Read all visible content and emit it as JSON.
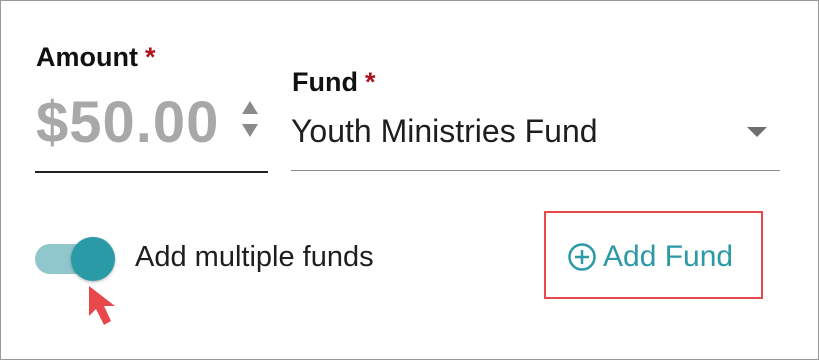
{
  "amount": {
    "label": "Amount",
    "required_marker": "*",
    "value": "$50.00"
  },
  "fund": {
    "label": "Fund",
    "required_marker": "*",
    "selected": "Youth Ministries Fund"
  },
  "multiple_funds": {
    "label": "Add multiple funds",
    "enabled": true
  },
  "add_fund": {
    "label": "Add Fund",
    "icon": "plus-circle-icon"
  },
  "colors": {
    "accent": "#2a9aa6",
    "toggle_track": "#8fc7cc",
    "required": "#b0121c",
    "highlight": "#e8474c"
  }
}
